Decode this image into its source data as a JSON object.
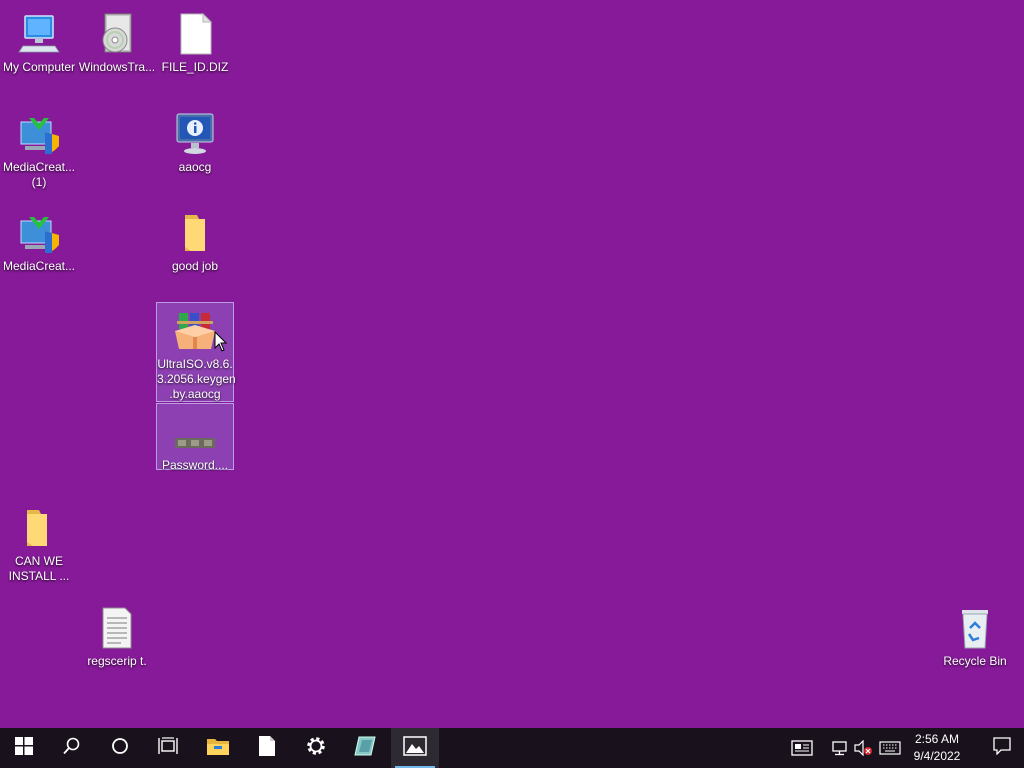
{
  "desktop": {
    "icons": {
      "my_computer": "My Computer",
      "windows_tra": "WindowsTra...",
      "file_id": "FILE_ID.DIZ",
      "media_creat_1": "MediaCreat...\n(1)",
      "aaocg": "aaocg",
      "media_creat": "MediaCreat...",
      "good_job": "good job",
      "ultraiso": "UltraISO.v8.6.\n3.2056.keygen\n.by.aaocg",
      "password": "Password....",
      "can_we_install": "CAN WE\nINSTALL ...",
      "regscript": "regscerip t.",
      "recycle_bin": "Recycle Bin"
    },
    "background_color": "#861a98"
  },
  "taskbar": {
    "clock_time": "2:56 AM",
    "clock_date": "9/4/2022",
    "icons": [
      "windows-start-icon",
      "search-icon",
      "cortana-icon",
      "task-view-icon",
      "file-explorer-icon",
      "notepad-icon",
      "settings-icon",
      "app-icon",
      "photos-icon"
    ],
    "tray_icons": [
      "news-icon",
      "network-icon",
      "volume-muted-icon",
      "keyboard-icon"
    ]
  }
}
